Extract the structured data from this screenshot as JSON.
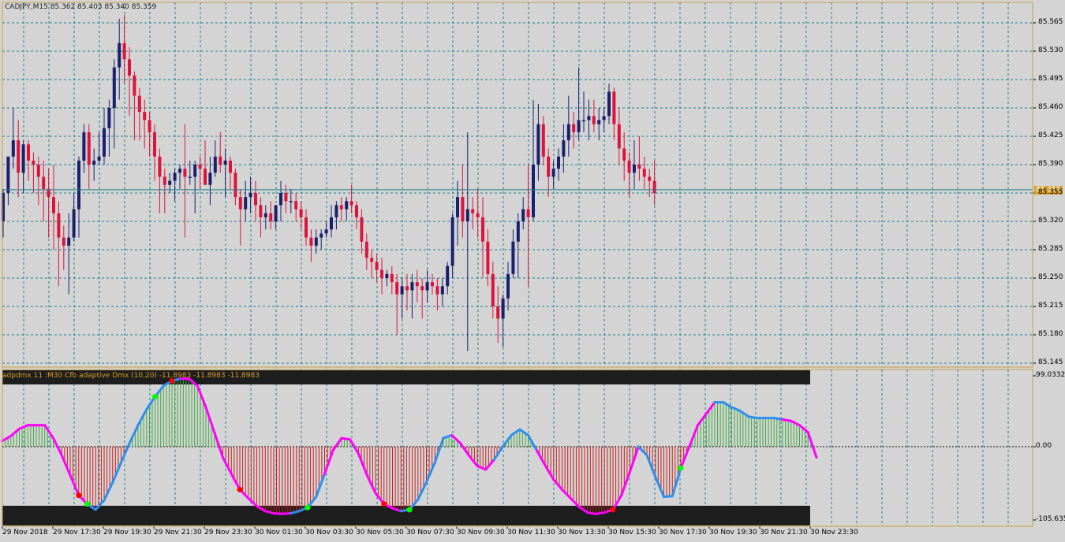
{
  "main": {
    "title": "CADJPY,M15  85.362 85.403 85.340 85.359",
    "last_price": "85.359",
    "price_axis": [
      "85.565",
      "85.530",
      "85.495",
      "85.460",
      "85.425",
      "85.390",
      "85.355",
      "85.320",
      "85.285",
      "85.250",
      "85.215",
      "85.180",
      "85.145"
    ],
    "symbol": "CADJPY",
    "timeframe": "M15"
  },
  "indicator": {
    "title": "adpdmx 11 :M30 Cfb adaptive Dmx (10,20) -11.8983 -11.8983 -11.8983",
    "axis": [
      "99.0332",
      "0.00",
      "-105.635"
    ]
  },
  "time_axis": [
    "29 Nov 2018",
    "29 Nov 17:30",
    "29 Nov 19:30",
    "29 Nov 21:30",
    "29 Nov 23:30",
    "30 Nov 01:30",
    "30 Nov 03:30",
    "30 Nov 05:30",
    "30 Nov 07:30",
    "30 Nov 09:30",
    "30 Nov 11:30",
    "30 Nov 13:30",
    "30 Nov 15:30",
    "30 Nov 17:30",
    "30 Nov 19:30",
    "30 Nov 21:30",
    "30 Nov 23:30"
  ],
  "colors": {
    "background": "#d4d4d4",
    "grid": "#20808a",
    "bull": "#1a1f6e",
    "bear": "#dc143c",
    "frame": "#c8a040",
    "ind_up": "#2b8ff0",
    "ind_down": "#ff00ff",
    "hist_pos": "#3caa3c",
    "hist_neg": "#c81e1e",
    "band": "#1e1e1e"
  },
  "candles": [
    [
      85.32,
      85.36,
      85.3,
      85.355
    ],
    [
      85.355,
      85.395,
      85.34,
      85.4
    ],
    [
      85.4,
      85.46,
      85.385,
      85.42
    ],
    [
      85.42,
      85.445,
      85.35,
      85.38
    ],
    [
      85.38,
      85.42,
      85.355,
      85.415
    ],
    [
      85.415,
      85.42,
      85.37,
      85.395
    ],
    [
      85.395,
      85.405,
      85.355,
      85.39
    ],
    [
      85.39,
      85.4,
      85.34,
      85.375
    ],
    [
      85.375,
      85.395,
      85.32,
      85.36
    ],
    [
      85.36,
      85.385,
      85.3,
      85.35
    ],
    [
      85.35,
      85.39,
      85.285,
      85.33
    ],
    [
      85.33,
      85.345,
      85.24,
      85.3
    ],
    [
      85.3,
      85.315,
      85.26,
      85.29
    ],
    [
      85.29,
      85.33,
      85.23,
      85.3
    ],
    [
      85.3,
      85.355,
      85.295,
      85.335
    ],
    [
      85.335,
      85.4,
      85.3,
      85.395
    ],
    [
      85.395,
      85.44,
      85.38,
      85.43
    ],
    [
      85.43,
      85.44,
      85.36,
      85.39
    ],
    [
      85.39,
      85.41,
      85.37,
      85.395
    ],
    [
      85.395,
      85.43,
      85.39,
      85.4
    ],
    [
      85.4,
      85.46,
      85.39,
      85.435
    ],
    [
      85.435,
      85.47,
      85.4,
      85.46
    ],
    [
      85.46,
      85.52,
      85.41,
      85.51
    ],
    [
      85.51,
      85.57,
      85.47,
      85.54
    ],
    [
      85.54,
      85.575,
      85.49,
      85.52
    ],
    [
      85.52,
      85.535,
      85.45,
      85.5
    ],
    [
      85.5,
      85.505,
      85.42,
      85.475
    ],
    [
      85.475,
      85.485,
      85.42,
      85.455
    ],
    [
      85.455,
      85.47,
      85.41,
      85.445
    ],
    [
      85.445,
      85.455,
      85.4,
      85.43
    ],
    [
      85.43,
      85.44,
      85.37,
      85.4
    ],
    [
      85.4,
      85.41,
      85.33,
      85.375
    ],
    [
      85.375,
      85.385,
      85.33,
      85.365
    ],
    [
      85.365,
      85.38,
      85.355,
      85.37
    ],
    [
      85.37,
      85.385,
      85.345,
      85.38
    ],
    [
      85.38,
      85.39,
      85.36,
      85.385
    ],
    [
      85.385,
      85.44,
      85.3,
      85.375
    ],
    [
      85.375,
      85.395,
      85.365,
      85.375
    ],
    [
      85.375,
      85.395,
      85.33,
      85.39
    ],
    [
      85.39,
      85.4,
      85.36,
      85.385
    ],
    [
      85.385,
      85.42,
      85.37,
      85.365
    ],
    [
      85.365,
      85.4,
      85.34,
      85.38
    ],
    [
      85.38,
      85.42,
      85.375,
      85.4
    ],
    [
      85.4,
      85.43,
      85.38,
      85.39
    ],
    [
      85.39,
      85.41,
      85.35,
      85.395
    ],
    [
      85.395,
      85.4,
      85.36,
      85.38
    ],
    [
      85.38,
      85.385,
      85.34,
      85.35
    ],
    [
      85.35,
      85.36,
      85.29,
      85.335
    ],
    [
      85.335,
      85.37,
      85.32,
      85.35
    ],
    [
      85.35,
      85.375,
      85.33,
      85.355
    ],
    [
      85.355,
      85.37,
      85.32,
      85.34
    ],
    [
      85.34,
      85.35,
      85.3,
      85.325
    ],
    [
      85.325,
      85.34,
      85.31,
      85.33
    ],
    [
      85.33,
      85.345,
      85.31,
      85.32
    ],
    [
      85.32,
      85.335,
      85.31,
      85.34
    ],
    [
      85.34,
      85.37,
      85.32,
      85.355
    ],
    [
      85.355,
      85.365,
      85.33,
      85.345
    ],
    [
      85.345,
      85.36,
      85.33,
      85.345
    ],
    [
      85.345,
      85.355,
      85.32,
      85.335
    ],
    [
      85.335,
      85.345,
      85.31,
      85.325
    ],
    [
      85.325,
      85.335,
      85.29,
      85.3
    ],
    [
      85.3,
      85.31,
      85.27,
      85.29
    ],
    [
      85.29,
      85.31,
      85.28,
      85.3
    ],
    [
      85.3,
      85.31,
      85.285,
      85.305
    ],
    [
      85.305,
      85.32,
      85.3,
      85.31
    ],
    [
      85.31,
      85.34,
      85.3,
      85.325
    ],
    [
      85.325,
      85.345,
      85.31,
      85.34
    ],
    [
      85.34,
      85.35,
      85.32,
      85.335
    ],
    [
      85.335,
      85.35,
      85.32,
      85.345
    ],
    [
      85.345,
      85.365,
      85.33,
      85.34
    ],
    [
      85.34,
      85.345,
      85.31,
      85.325
    ],
    [
      85.325,
      85.335,
      85.28,
      85.295
    ],
    [
      85.295,
      85.305,
      85.26,
      85.275
    ],
    [
      85.275,
      85.285,
      85.25,
      85.27
    ],
    [
      85.27,
      85.28,
      85.245,
      85.26
    ],
    [
      85.26,
      85.275,
      85.23,
      85.25
    ],
    [
      85.25,
      85.26,
      85.24,
      85.255
    ],
    [
      85.255,
      85.265,
      85.23,
      85.245
    ],
    [
      85.245,
      85.255,
      85.18,
      85.23
    ],
    [
      85.23,
      85.25,
      85.2,
      85.24
    ],
    [
      85.24,
      85.255,
      85.21,
      85.235
    ],
    [
      85.235,
      85.255,
      85.2,
      85.245
    ],
    [
      85.245,
      85.26,
      85.22,
      85.24
    ],
    [
      85.24,
      85.25,
      85.2,
      85.235
    ],
    [
      85.235,
      85.26,
      85.22,
      85.245
    ],
    [
      85.245,
      85.255,
      85.23,
      85.24
    ],
    [
      85.24,
      85.25,
      85.21,
      85.23
    ],
    [
      85.23,
      85.25,
      85.215,
      85.24
    ],
    [
      85.24,
      85.27,
      85.23,
      85.265
    ],
    [
      85.265,
      85.33,
      85.25,
      85.325
    ],
    [
      85.325,
      85.37,
      85.29,
      85.35
    ],
    [
      85.35,
      85.39,
      85.3,
      85.32
    ],
    [
      85.32,
      85.43,
      85.16,
      85.335
    ],
    [
      85.335,
      85.35,
      85.31,
      85.33
    ],
    [
      85.33,
      85.36,
      85.3,
      85.325
    ],
    [
      85.325,
      85.35,
      85.25,
      85.295
    ],
    [
      85.295,
      85.31,
      85.24,
      85.255
    ],
    [
      85.255,
      85.27,
      85.2,
      85.215
    ],
    [
      85.215,
      85.24,
      85.17,
      85.2
    ],
    [
      85.2,
      85.23,
      85.165,
      85.225
    ],
    [
      85.225,
      85.27,
      85.21,
      85.255
    ],
    [
      85.255,
      85.31,
      85.25,
      85.295
    ],
    [
      85.295,
      85.33,
      85.25,
      85.32
    ],
    [
      85.32,
      85.35,
      85.31,
      85.335
    ],
    [
      85.335,
      85.39,
      85.24,
      85.325
    ],
    [
      85.325,
      85.47,
      85.32,
      85.39
    ],
    [
      85.39,
      85.465,
      85.37,
      85.44
    ],
    [
      85.44,
      85.45,
      85.39,
      85.4
    ],
    [
      85.4,
      85.41,
      85.35,
      85.375
    ],
    [
      85.375,
      85.395,
      85.36,
      85.385
    ],
    [
      85.385,
      85.41,
      85.37,
      85.4
    ],
    [
      85.4,
      85.44,
      85.38,
      85.42
    ],
    [
      85.42,
      85.475,
      85.4,
      85.44
    ],
    [
      85.44,
      85.455,
      85.41,
      85.43
    ],
    [
      85.43,
      85.51,
      85.42,
      85.445
    ],
    [
      85.445,
      85.48,
      85.43,
      85.445
    ],
    [
      85.445,
      85.47,
      85.42,
      85.45
    ],
    [
      85.45,
      85.47,
      85.43,
      85.44
    ],
    [
      85.44,
      85.46,
      85.42,
      85.445
    ],
    [
      85.445,
      85.46,
      85.43,
      85.45
    ],
    [
      85.45,
      85.49,
      85.44,
      85.48
    ],
    [
      85.48,
      85.485,
      85.42,
      85.44
    ],
    [
      85.44,
      85.46,
      85.39,
      85.41
    ],
    [
      85.41,
      85.43,
      85.37,
      85.395
    ],
    [
      85.395,
      85.405,
      85.35,
      85.38
    ],
    [
      85.38,
      85.42,
      85.36,
      85.39
    ],
    [
      85.39,
      85.425,
      85.37,
      85.385
    ],
    [
      85.385,
      85.4,
      85.36,
      85.375
    ],
    [
      85.375,
      85.385,
      85.35,
      85.37
    ],
    [
      85.37,
      85.395,
      85.34,
      85.355
    ]
  ],
  "indicator_values": [
    8,
    15,
    25,
    30,
    30,
    30,
    12,
    -12,
    -40,
    -68,
    -80,
    -88,
    -75,
    -50,
    -22,
    5,
    30,
    52,
    70,
    85,
    92,
    95,
    95,
    85,
    55,
    20,
    -15,
    -38,
    -60,
    -72,
    -83,
    -90,
    -93,
    -94,
    -93,
    -90,
    -85,
    -70,
    -38,
    -5,
    12,
    10,
    -10,
    -40,
    -65,
    -80,
    -86,
    -90,
    -88,
    -74,
    -50,
    -22,
    12,
    16,
    5,
    -12,
    -27,
    -32,
    -18,
    0,
    16,
    24,
    16,
    -5,
    -26,
    -46,
    -60,
    -72,
    -84,
    -92,
    -94,
    -92,
    -88,
    -68,
    -35,
    0,
    -12,
    -42,
    -70,
    -69,
    -30,
    0,
    30,
    46,
    62,
    62,
    55,
    50,
    42,
    40,
    40,
    40,
    38,
    36,
    30,
    20,
    -15
  ],
  "ind_colors": "dddddddddduuuuuuuuuuuddddddddddddduuuuddddddddduuuuuuddddduuuuudddddddddddduuuuudddduuuuuuuudddddddddddd"
}
